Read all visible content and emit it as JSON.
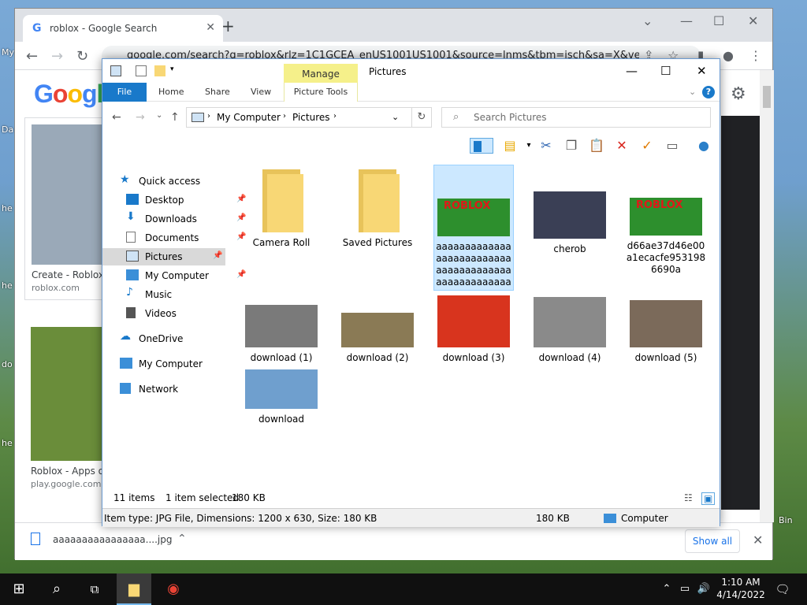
{
  "desktop": {
    "labels": [
      "My",
      "Da",
      "he",
      "he",
      "do",
      "he",
      "Bin"
    ]
  },
  "chrome": {
    "tab_title": "roblox - Google Search",
    "url": "google.com/search?q=roblox&rlz=1C1GCEA_enUS1001US1001&source=lnms&tbm=isch&sa=X&ved",
    "google_logo": "Google",
    "results": [
      {
        "caption": "Create - Roblox",
        "source": "roblox.com"
      },
      {
        "caption": "Roblox - Apps o",
        "source": "play.google.com"
      }
    ],
    "download_file": "aaaaaaaaaaaaaaaa....jpg",
    "show_all": "Show all"
  },
  "explorer": {
    "title": "Pictures",
    "manage_tab": "Manage",
    "ribbon_tabs": [
      "File",
      "Home",
      "Share",
      "View",
      "Picture Tools"
    ],
    "breadcrumb": [
      "My Computer",
      "Pictures"
    ],
    "search_placeholder": "Search Pictures",
    "nav_items": [
      {
        "label": "Quick access",
        "pinned": false
      },
      {
        "label": "Desktop",
        "pinned": true
      },
      {
        "label": "Downloads",
        "pinned": true
      },
      {
        "label": "Documents",
        "pinned": true
      },
      {
        "label": "Pictures",
        "pinned": true,
        "selected": true
      },
      {
        "label": "My Computer",
        "pinned": true
      },
      {
        "label": "Music",
        "pinned": false
      },
      {
        "label": "Videos",
        "pinned": false
      },
      {
        "label": "OneDrive",
        "pinned": false
      },
      {
        "label": "My Computer",
        "pinned": false
      },
      {
        "label": "Network",
        "pinned": false
      }
    ],
    "files": [
      {
        "name": "Camera Roll",
        "kind": "folder"
      },
      {
        "name": "Saved Pictures",
        "kind": "folder"
      },
      {
        "name": "aaaaaaaaaaaaaaaaaaaaaaaaaaaaaaaaaaaaaaaaaaaaaaaaaaaaaaaaa...",
        "kind": "image",
        "selected": true,
        "color": "#2d8f2d"
      },
      {
        "name": "cherob",
        "kind": "image",
        "color": "#3a3f55"
      },
      {
        "name": "d66ae37d46e00a1ecacfe9531986690a",
        "kind": "image",
        "color": "#2d8f2d"
      },
      {
        "name": "download (1)",
        "kind": "image",
        "color": "#7a7a7a"
      },
      {
        "name": "download (2)",
        "kind": "image",
        "color": "#8a7a55"
      },
      {
        "name": "download (3)",
        "kind": "image",
        "color": "#d8341e"
      },
      {
        "name": "download (4)",
        "kind": "image",
        "color": "#8a8a8a"
      },
      {
        "name": "download (5)",
        "kind": "image",
        "color": "#7b6a5a"
      },
      {
        "name": "download",
        "kind": "image",
        "color": "#6f9fce"
      }
    ],
    "status": {
      "items": "11 items",
      "selected": "1 item selected",
      "size": "180 KB"
    },
    "details": {
      "type_info": "Item type: JPG File, Dimensions: 1200 x 630, Size: 180 KB",
      "size": "180 KB",
      "location": "Computer"
    }
  },
  "taskbar": {
    "time": "1:10 AM",
    "date": "4/14/2022"
  }
}
